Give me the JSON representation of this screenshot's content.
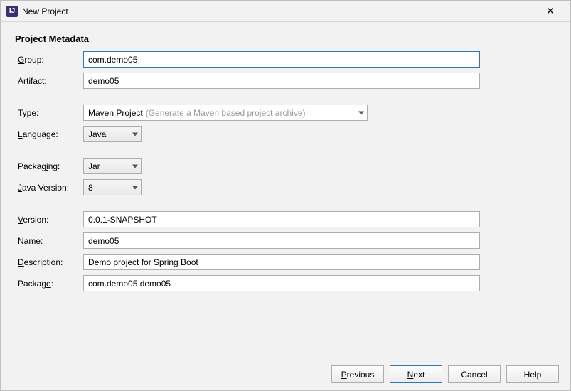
{
  "window": {
    "title": "New Project",
    "app_icon_text": "IJ"
  },
  "section_title": "Project Metadata",
  "labels": {
    "group": {
      "pre": "",
      "ul": "G",
      "post": "roup:"
    },
    "artifact": {
      "pre": "",
      "ul": "A",
      "post": "rtifact:"
    },
    "type": {
      "pre": "",
      "ul": "T",
      "post": "ype:"
    },
    "language": {
      "pre": "",
      "ul": "L",
      "post": "anguage:"
    },
    "packaging": {
      "pre": "Packag",
      "ul": "i",
      "post": "ng:"
    },
    "javaVersion": {
      "pre": "",
      "ul": "J",
      "post": "ava Version:"
    },
    "version": {
      "pre": "",
      "ul": "V",
      "post": "ersion:"
    },
    "name": {
      "pre": "Na",
      "ul": "m",
      "post": "e:"
    },
    "description": {
      "pre": "",
      "ul": "D",
      "post": "escription:"
    },
    "package": {
      "pre": "Packag",
      "ul": "e",
      "post": ":"
    }
  },
  "fields": {
    "group": "com.demo05",
    "artifact": "demo05",
    "type_main": "Maven Project",
    "type_hint": "(Generate a Maven based project archive)",
    "language": "Java",
    "packaging": "Jar",
    "javaVersion": "8",
    "version": "0.0.1-SNAPSHOT",
    "name": "demo05",
    "description": "Demo project for Spring Boot",
    "package": "com.demo05.demo05"
  },
  "buttons": {
    "previous": {
      "pre": "",
      "ul": "P",
      "post": "revious"
    },
    "next": {
      "pre": "",
      "ul": "N",
      "post": "ext"
    },
    "cancel": "Cancel",
    "help": "Help"
  }
}
